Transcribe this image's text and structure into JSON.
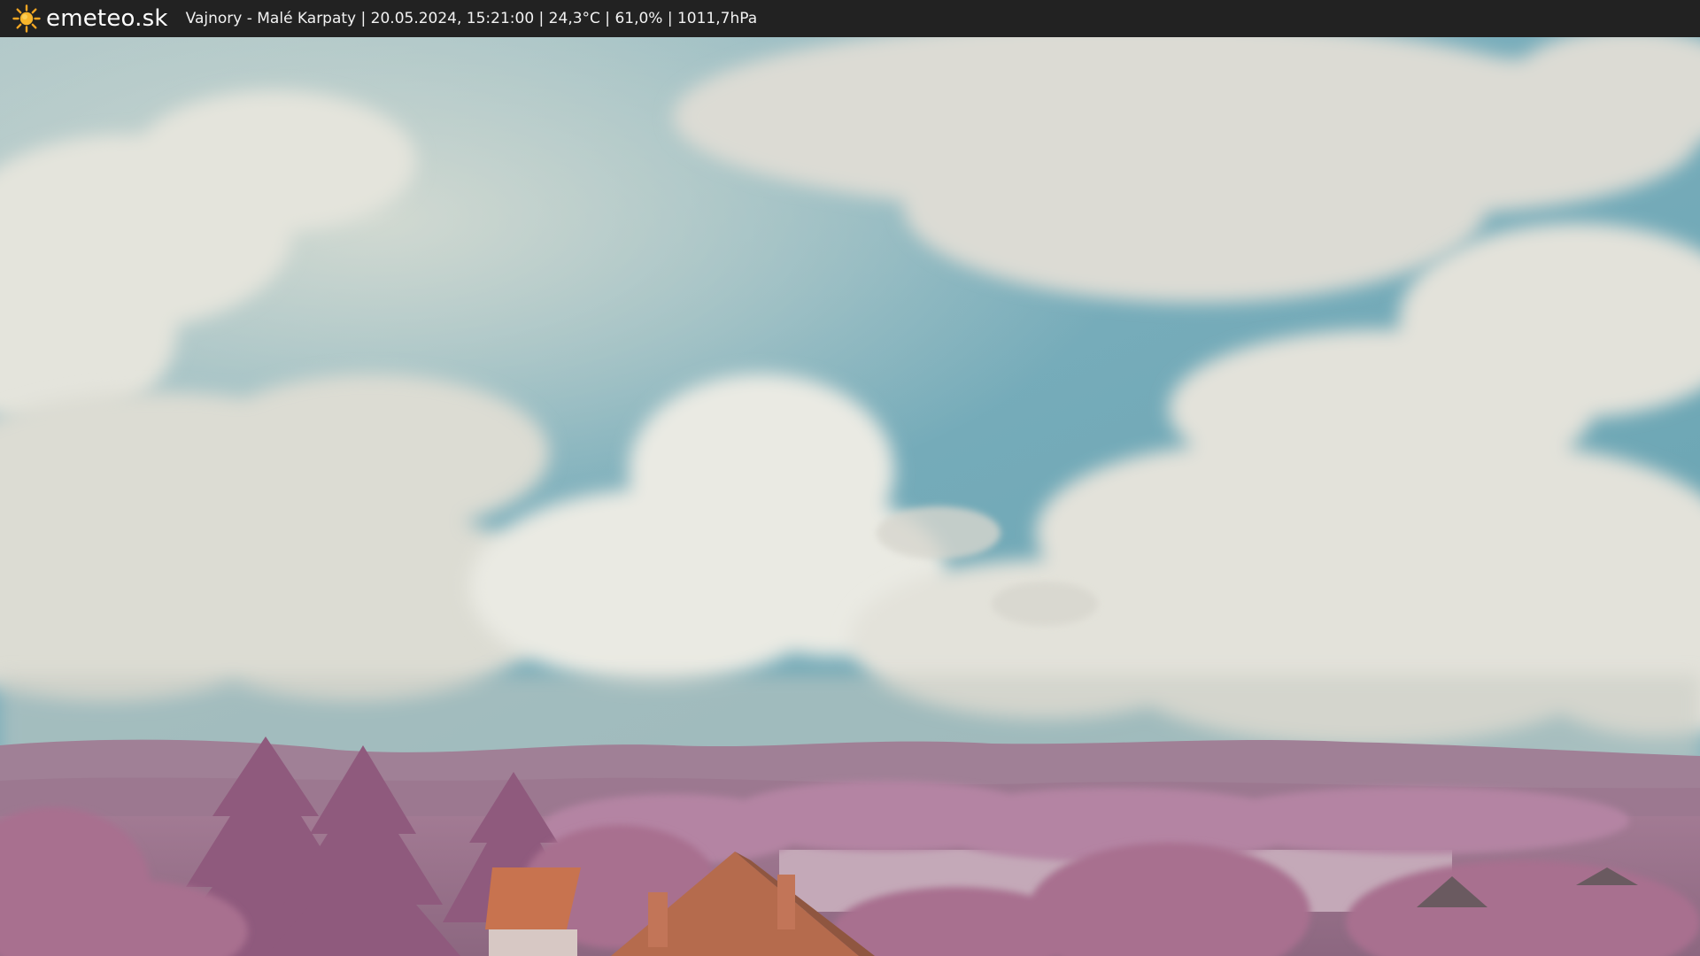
{
  "header": {
    "brand": "emeteo.sk",
    "brand_icon": "sun-icon",
    "caption": "Vajnory - Malé Karpaty | 20.05.2024, 15:21:00 | 24,3°C | 61,0% | 1011,7hPa"
  },
  "colors": {
    "header_bg": "#222222",
    "sun": "#f5a623",
    "sky": "#7fb0bd",
    "foliage": "#b07a99"
  }
}
